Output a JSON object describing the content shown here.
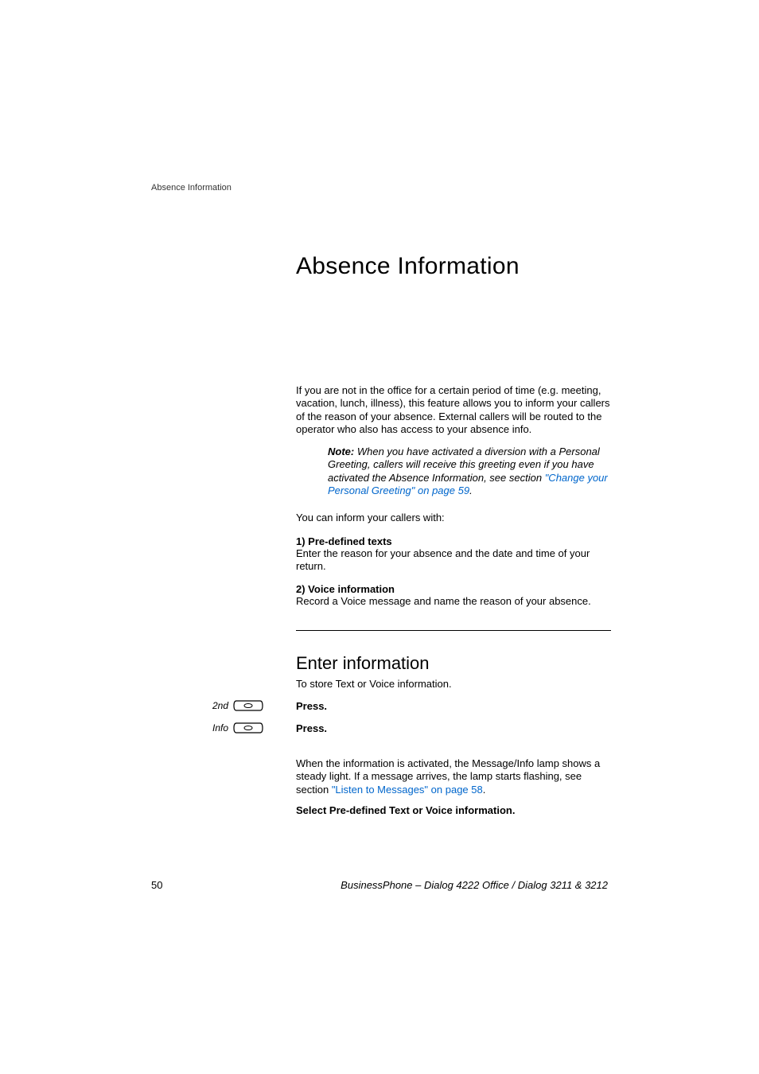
{
  "header": {
    "running_head": "Absence Information"
  },
  "title": "Absence Information",
  "intro": "If you are not in the office for a certain period of time (e.g. meeting, vacation, lunch, illness), this feature allows you to inform your callers of the reason of your absence. External callers will be routed to the operator who also has access to your absence info.",
  "note": {
    "label": "Note:",
    "body_before_link": "When you have activated a diversion with a Personal Greeting, callers will receive this greeting even if you have activated the Absence Information, see section ",
    "link_text": "\"Change your Personal Greeting\" on page 59",
    "after_link": "."
  },
  "inform_line": "You can inform your callers with:",
  "section1": {
    "title": "1) Pre-defined texts",
    "body": "Enter the reason for your absence and the date and time of your return."
  },
  "section2": {
    "title": "2) Voice information",
    "body": "Record a Voice message and name the reason of your absence."
  },
  "subtitle": "Enter information",
  "subtitle_desc": "To store Text or Voice information.",
  "buttons": {
    "btn1_label": "2nd",
    "btn1_action": "Press.",
    "btn2_label": "Info",
    "btn2_action": "Press."
  },
  "activation": {
    "before_link": "When the information is activated, the Message/Info lamp shows a steady light. If a message arrives, the lamp starts flashing, see section ",
    "link_text": "\"Listen to Messages\" on page 58",
    "after_link": "."
  },
  "select_line": "Select Pre-defined Text or Voice information.",
  "footer": {
    "page_number": "50",
    "text": "BusinessPhone – Dialog 4222 Office / Dialog 3211 & 3212"
  }
}
